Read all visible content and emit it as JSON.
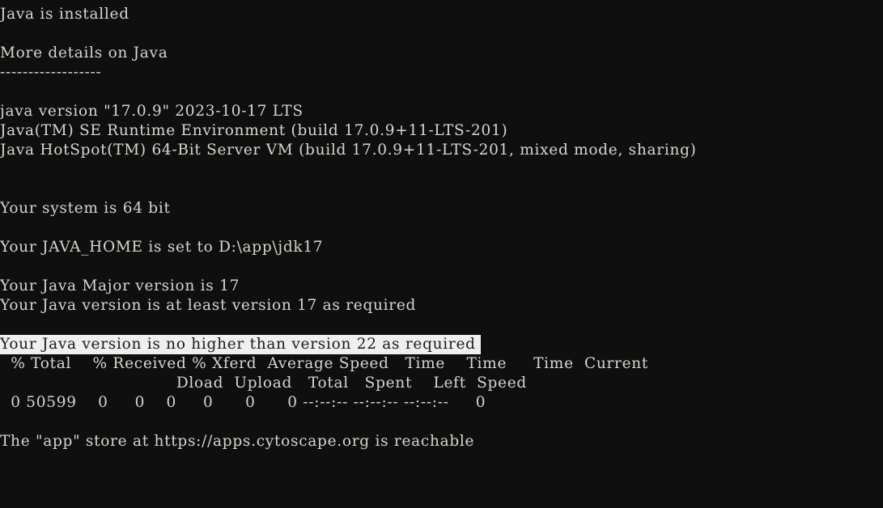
{
  "terminal": {
    "background_color": "#0f0f0f",
    "foreground_color": "#d9d5cd",
    "highlight_background_color": "#efefef",
    "highlight_foreground_color": "#1b1b1b",
    "lines": [
      {
        "id": "java-installed",
        "text": "Java is installed",
        "style": "normal"
      },
      {
        "id": "blank-1",
        "text": " ",
        "style": "blank"
      },
      {
        "id": "more-details-heading",
        "text": "More details on Java",
        "style": "normal"
      },
      {
        "id": "heading-rule",
        "text": "------------------",
        "style": "normal"
      },
      {
        "id": "blank-2",
        "text": " ",
        "style": "blank"
      },
      {
        "id": "java-version",
        "text": "java version \"17.0.9\" 2023-10-17 LTS",
        "style": "normal"
      },
      {
        "id": "java-runtime",
        "text": "Java(TM) SE Runtime Environment (build 17.0.9+11-LTS-201)",
        "style": "normal"
      },
      {
        "id": "java-hotspot",
        "text": "Java HotSpot(TM) 64-Bit Server VM (build 17.0.9+11-LTS-201, mixed mode, sharing)",
        "style": "normal"
      },
      {
        "id": "blank-3",
        "text": " ",
        "style": "blank"
      },
      {
        "id": "blank-4",
        "text": " ",
        "style": "blank"
      },
      {
        "id": "system-bitness",
        "text": "Your system is 64 bit",
        "style": "normal"
      },
      {
        "id": "blank-5",
        "text": " ",
        "style": "blank"
      },
      {
        "id": "java-home",
        "text": "Your JAVA_HOME is set to D:\\app\\jdk17",
        "style": "normal"
      },
      {
        "id": "blank-6",
        "text": " ",
        "style": "blank"
      },
      {
        "id": "java-major-version",
        "text": "Your Java Major version is 17",
        "style": "normal"
      },
      {
        "id": "java-min-version-ok",
        "text": "Your Java version is at least version 17 as required",
        "style": "normal"
      },
      {
        "id": "blank-7",
        "text": " ",
        "style": "blank"
      },
      {
        "id": "java-max-version-ok",
        "text": "Your Java version is no higher than version 22 as required ",
        "style": "highlight"
      },
      {
        "id": "curl-header-row-1",
        "text": "  % Total    % Received % Xferd  Average Speed   Time    Time     Time  Current",
        "style": "normal"
      },
      {
        "id": "curl-header-row-2",
        "text": "                                 Dload  Upload   Total   Spent    Left  Speed",
        "style": "normal"
      },
      {
        "id": "curl-progress-row",
        "text": "  0 50599    0     0    0     0      0      0 --:--:-- --:--:-- --:--:--     0",
        "style": "normal"
      },
      {
        "id": "blank-8",
        "text": " ",
        "style": "blank"
      },
      {
        "id": "app-store-reachable",
        "text": "The \"app\" store at https://apps.cytoscape.org is reachable",
        "style": "normal"
      }
    ]
  },
  "details": {
    "java_status": "Java is installed",
    "section_heading": "More details on Java",
    "java_version": "17.0.9",
    "java_version_date": "2023-10-17",
    "java_release_type": "LTS",
    "java_build": "17.0.9+11-LTS-201",
    "jvm_mode": "mixed mode, sharing",
    "system_bitness": "64 bit",
    "java_home_path": "D:\\app\\jdk17",
    "java_major_version": "17",
    "min_required_version": "17",
    "max_allowed_version": "22",
    "app_store_url": "https://apps.cytoscape.org",
    "app_store_status": "reachable"
  },
  "curl_transfer": {
    "columns": [
      "% Total",
      "% Received",
      "% Xferd",
      "Average Speed Dload",
      "Average Speed Upload",
      "Time Total",
      "Time Spent",
      "Time Left",
      "Current Speed"
    ],
    "values": [
      "0",
      "50599",
      "0",
      "0",
      "0",
      "0",
      "0",
      "0",
      "--:--:--",
      "--:--:--",
      "--:--:--",
      "0"
    ],
    "percent_total": "0",
    "total_bytes": "50599",
    "percent_received": "0",
    "received_bytes": "0",
    "percent_xferd": "0",
    "xferd_bytes": "0",
    "dload_speed": "0",
    "upload_speed": "0",
    "time_total": "--:--:--",
    "time_spent": "--:--:--",
    "time_left": "--:--:--",
    "current_speed": "0"
  }
}
